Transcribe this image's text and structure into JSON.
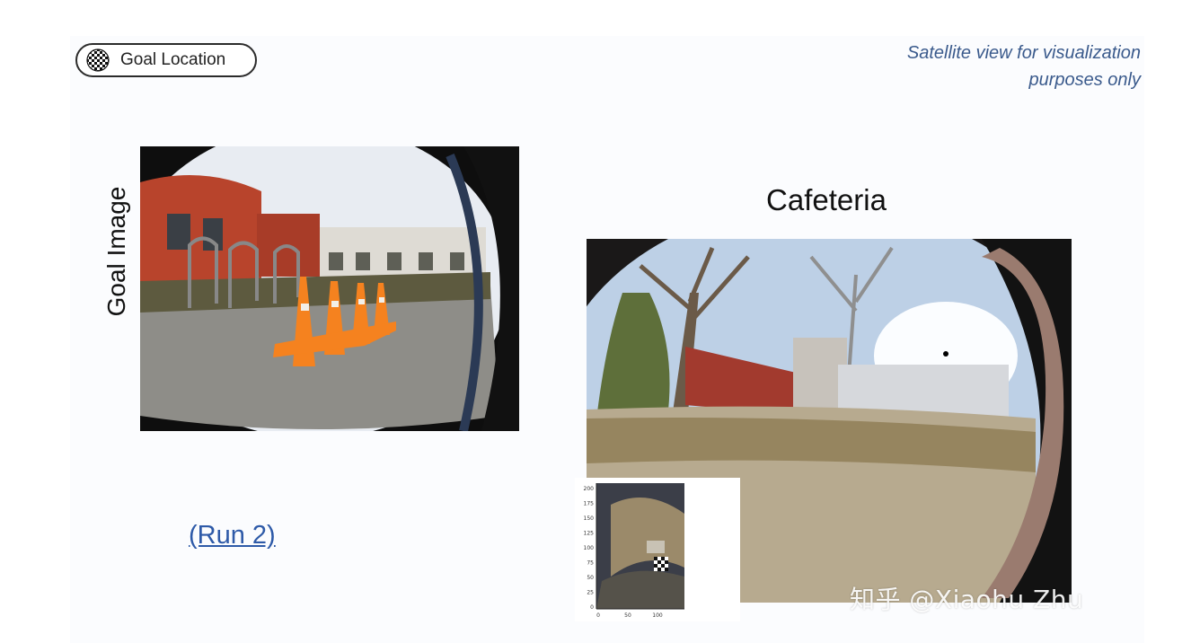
{
  "legend": {
    "label": "Goal Location",
    "icon": "checkered-flag-icon"
  },
  "note": {
    "line1": "Satellite view for visualization",
    "line2": "purposes only"
  },
  "goal_image_label": "Goal Image",
  "location_title": "Cafeteria",
  "run_link": "(Run 2)",
  "inset_map": {
    "y_ticks": [
      "200",
      "175",
      "150",
      "125",
      "100",
      "75",
      "50",
      "25",
      "0"
    ],
    "x_ticks": [
      "0",
      "50",
      "100"
    ]
  },
  "watermark": "知乎 @Xiaohu Zhu",
  "colors": {
    "accent": "#3a5a8c",
    "link": "#2e5aa8",
    "cone": "#f5821f"
  }
}
